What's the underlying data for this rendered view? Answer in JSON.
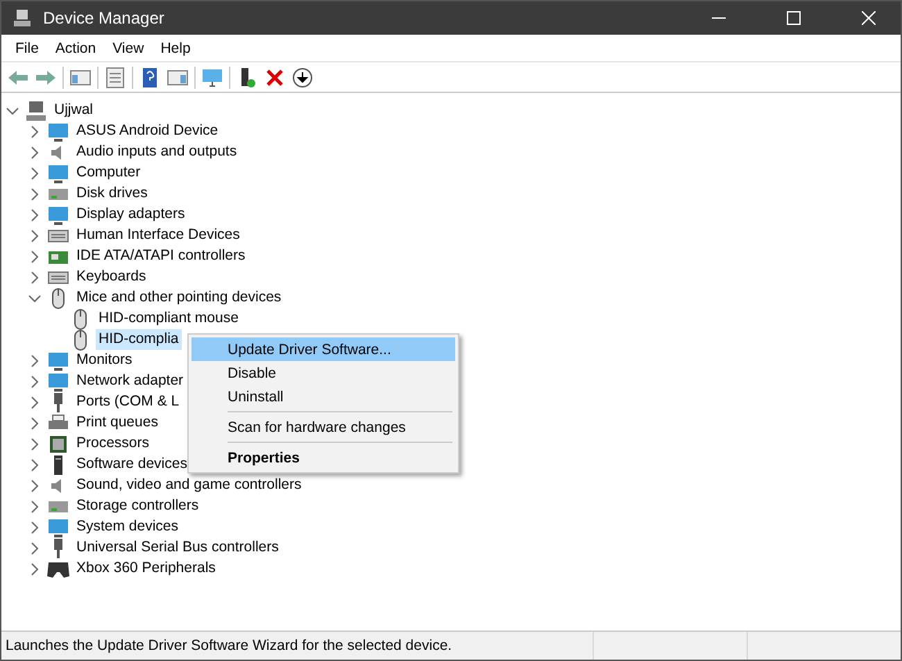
{
  "window": {
    "title": "Device Manager"
  },
  "menu_bar": [
    "File",
    "Action",
    "View",
    "Help"
  ],
  "tree": {
    "label": "Ujjwal",
    "expanded": true,
    "children": [
      {
        "label": "ASUS Android Device",
        "expanded": false
      },
      {
        "label": "Audio inputs and outputs",
        "expanded": false
      },
      {
        "label": "Computer",
        "expanded": false
      },
      {
        "label": "Disk drives",
        "expanded": false
      },
      {
        "label": "Display adapters",
        "expanded": false
      },
      {
        "label": "Human Interface Devices",
        "expanded": false
      },
      {
        "label": "IDE ATA/ATAPI controllers",
        "expanded": false
      },
      {
        "label": "Keyboards",
        "expanded": false
      },
      {
        "label": "Mice and other pointing devices",
        "expanded": true,
        "children": [
          {
            "label": "HID-compliant mouse",
            "selected": false
          },
          {
            "label": "HID-complia",
            "selected": true
          }
        ]
      },
      {
        "label": "Monitors",
        "expanded": false
      },
      {
        "label": "Network adapter",
        "expanded": false
      },
      {
        "label": "Ports (COM & L",
        "expanded": false
      },
      {
        "label": "Print queues",
        "expanded": false
      },
      {
        "label": "Processors",
        "expanded": false
      },
      {
        "label": "Software devices",
        "expanded": false
      },
      {
        "label": "Sound, video and game controllers",
        "expanded": false
      },
      {
        "label": "Storage controllers",
        "expanded": false
      },
      {
        "label": "System devices",
        "expanded": false
      },
      {
        "label": "Universal Serial Bus controllers",
        "expanded": false
      },
      {
        "label": "Xbox 360 Peripherals",
        "expanded": false
      }
    ]
  },
  "context_menu": [
    {
      "kind": "item",
      "label": "Update Driver Software...",
      "selected": true
    },
    {
      "kind": "item",
      "label": "Disable",
      "selected": false
    },
    {
      "kind": "item",
      "label": "Uninstall",
      "selected": false
    },
    {
      "kind": "separator"
    },
    {
      "kind": "item",
      "label": "Scan for hardware changes",
      "selected": false
    },
    {
      "kind": "separator"
    },
    {
      "kind": "default",
      "label": "Properties",
      "selected": false
    }
  ],
  "status_bar": {
    "text": "Launches the Update Driver Software Wizard for the selected device."
  }
}
